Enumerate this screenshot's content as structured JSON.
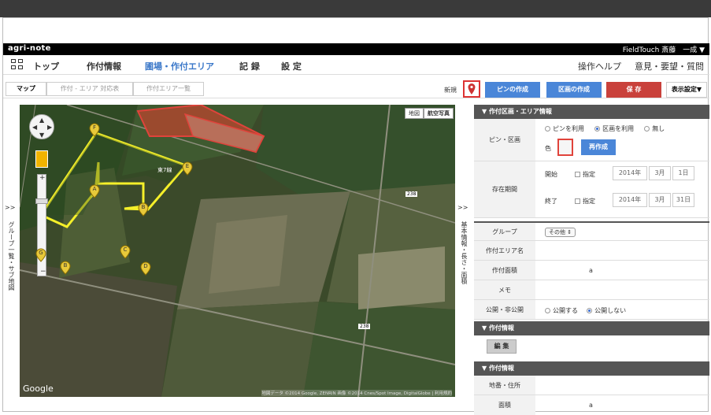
{
  "brand": {
    "logo": "agri-note",
    "user_area": "FieldTouch  斎藤　一成 ▼"
  },
  "nav": {
    "top": "トップ",
    "crop_info": "作付情報",
    "field_area": "圃場・作付エリア",
    "record": "記 録",
    "settings": "設 定",
    "help": "操作ヘルプ",
    "feedback": "意見・要望・質問"
  },
  "subtabs": {
    "map": "マップ",
    "mapping": "作付 - エリア 対応表",
    "list": "作付エリア一覧"
  },
  "toolbar": {
    "new_label": "新規",
    "pin_create": "ピンの作成",
    "area_create": "区画の作成",
    "save": "保 存",
    "display_settings": "表示設定▼"
  },
  "map": {
    "map_btn": "地図",
    "satellite_btn": "航空写真",
    "google": "Google",
    "copyright": "地図データ ©2014 Google, ZENRIN 画像 ©2014 Cnes/Spot Image, DigitalGlobe | 利用規約",
    "road_label_1": "238",
    "road_label_2": "238",
    "place_label": "東7線",
    "pins": [
      "A",
      "B",
      "C",
      "D",
      "E",
      "F",
      "G",
      "B"
    ]
  },
  "side": {
    "left_arrow": ">>",
    "left_label": "グループ一覧・サブ地図",
    "mid_arrow": ">>",
    "mid_label": "基本情報・長さ・面積"
  },
  "panel": {
    "section1": "▼ 作付区画・エリア情報",
    "pin_area_label": "ピン・区画",
    "opt_pin": "ピンを利用",
    "opt_area": "区画を利用",
    "opt_none": "無し",
    "color_label": "色",
    "recreate": "再作成",
    "period_label": "存在期間",
    "start_label": "開始",
    "end_label": "終了",
    "specify": "指定",
    "start_year": "2014年",
    "start_month": "3月",
    "start_day": "1日",
    "end_year": "2014年",
    "end_month": "3月",
    "end_day": "31日",
    "group_label": "グループ",
    "group_value": "その他 ⇕",
    "area_name_label": "作付エリア名",
    "area_size_label": "作付面積",
    "area_unit": "a",
    "memo_label": "メモ",
    "public_label": "公開・非公開",
    "opt_public": "公開する",
    "opt_private": "公開しない",
    "section2": "▼ 作付情報",
    "edit": "編 集",
    "section3": "▼ 作付情報",
    "address_label": "地番・住所",
    "size_label": "面積",
    "size_unit": "a"
  },
  "colors": {
    "accent": "#4a86d8",
    "save": "#c9413b",
    "pin": "#e8c93a",
    "field_outline": "#f5f02a",
    "red_field": "#e0433b"
  }
}
